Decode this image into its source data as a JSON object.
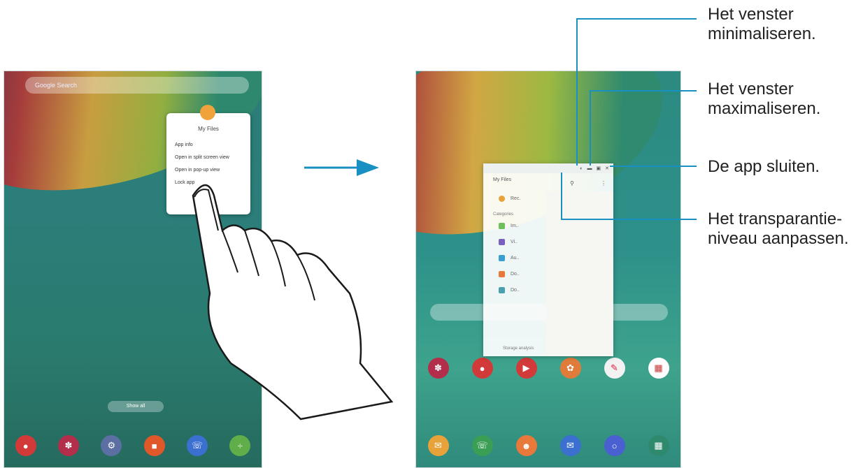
{
  "left_phone": {
    "search_placeholder": "Google Search",
    "context_menu": {
      "app_name": "My Files",
      "items": [
        "App info",
        "Open in split screen view",
        "Open in pop-up view",
        "Lock app"
      ]
    },
    "dock_button": "Show all",
    "dock_apps": [
      "camera",
      "galaxy-apps",
      "settings",
      "notes",
      "phone",
      "calculator"
    ]
  },
  "right_phone": {
    "popup": {
      "title": "My Files",
      "controls": [
        "transparency",
        "minimize",
        "maximize",
        "close"
      ],
      "categories_label": "Categories",
      "items": [
        "Rec.",
        "Im..",
        "Vi..",
        "Au..",
        "Do..",
        "Do.."
      ],
      "footer": "Storage analysis"
    },
    "dock_apps": [
      "galaxy-apps",
      "camera",
      "video",
      "gallery",
      "edit",
      "contacts"
    ],
    "bottom_apps": [
      "email",
      "phone",
      "contacts",
      "messages",
      "internet",
      "calendar"
    ]
  },
  "callouts": {
    "minimize": [
      "Het venster",
      "minimaliseren."
    ],
    "maximize": [
      "Het venster",
      "maximaliseren."
    ],
    "close": [
      "De app sluiten."
    ],
    "transparency": [
      "Het transparantie-",
      "niveau aanpassen."
    ]
  },
  "colors": {
    "callout_line": "#1a8fc2",
    "arrow": "#1a8fc2"
  }
}
